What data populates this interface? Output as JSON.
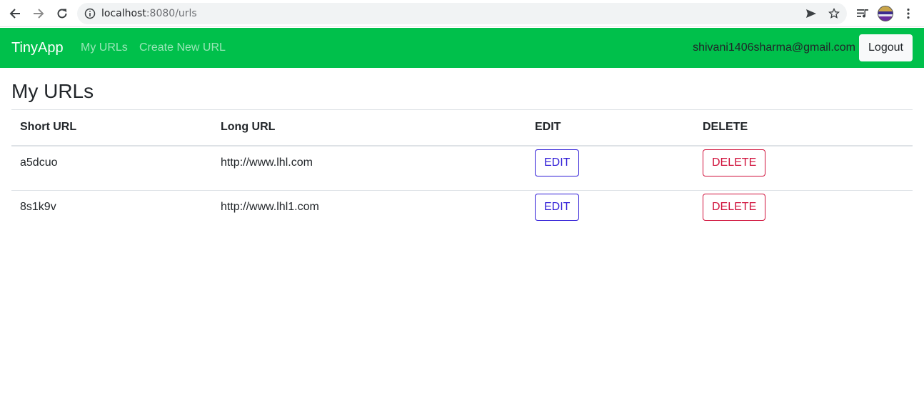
{
  "browser": {
    "url_host": "localhost",
    "url_rest": ":8080/urls"
  },
  "navbar": {
    "brand": "TinyApp",
    "links": [
      "My URLs",
      "Create New URL"
    ],
    "user_email": "shivani1406sharma@gmail.com",
    "logout_label": "Logout",
    "background_color": "#00c04b"
  },
  "main": {
    "title": "My URLs",
    "columns": [
      "Short URL",
      "Long URL",
      "EDIT",
      "DELETE"
    ],
    "rows": [
      {
        "short_url": "a5dcuo",
        "long_url": "http://www.lhl.com",
        "edit_label": "EDIT",
        "delete_label": "DELETE"
      },
      {
        "short_url": "8s1k9v",
        "long_url": "http://www.lhl1.com",
        "edit_label": "EDIT",
        "delete_label": "DELETE"
      }
    ]
  },
  "icons": {
    "back": "arrow-left-icon",
    "forward": "arrow-right-icon",
    "reload": "reload-icon",
    "info": "info-icon",
    "send": "send-icon",
    "bookmark": "star-icon",
    "media": "media-queue-icon",
    "menu": "kebab-menu-icon"
  }
}
